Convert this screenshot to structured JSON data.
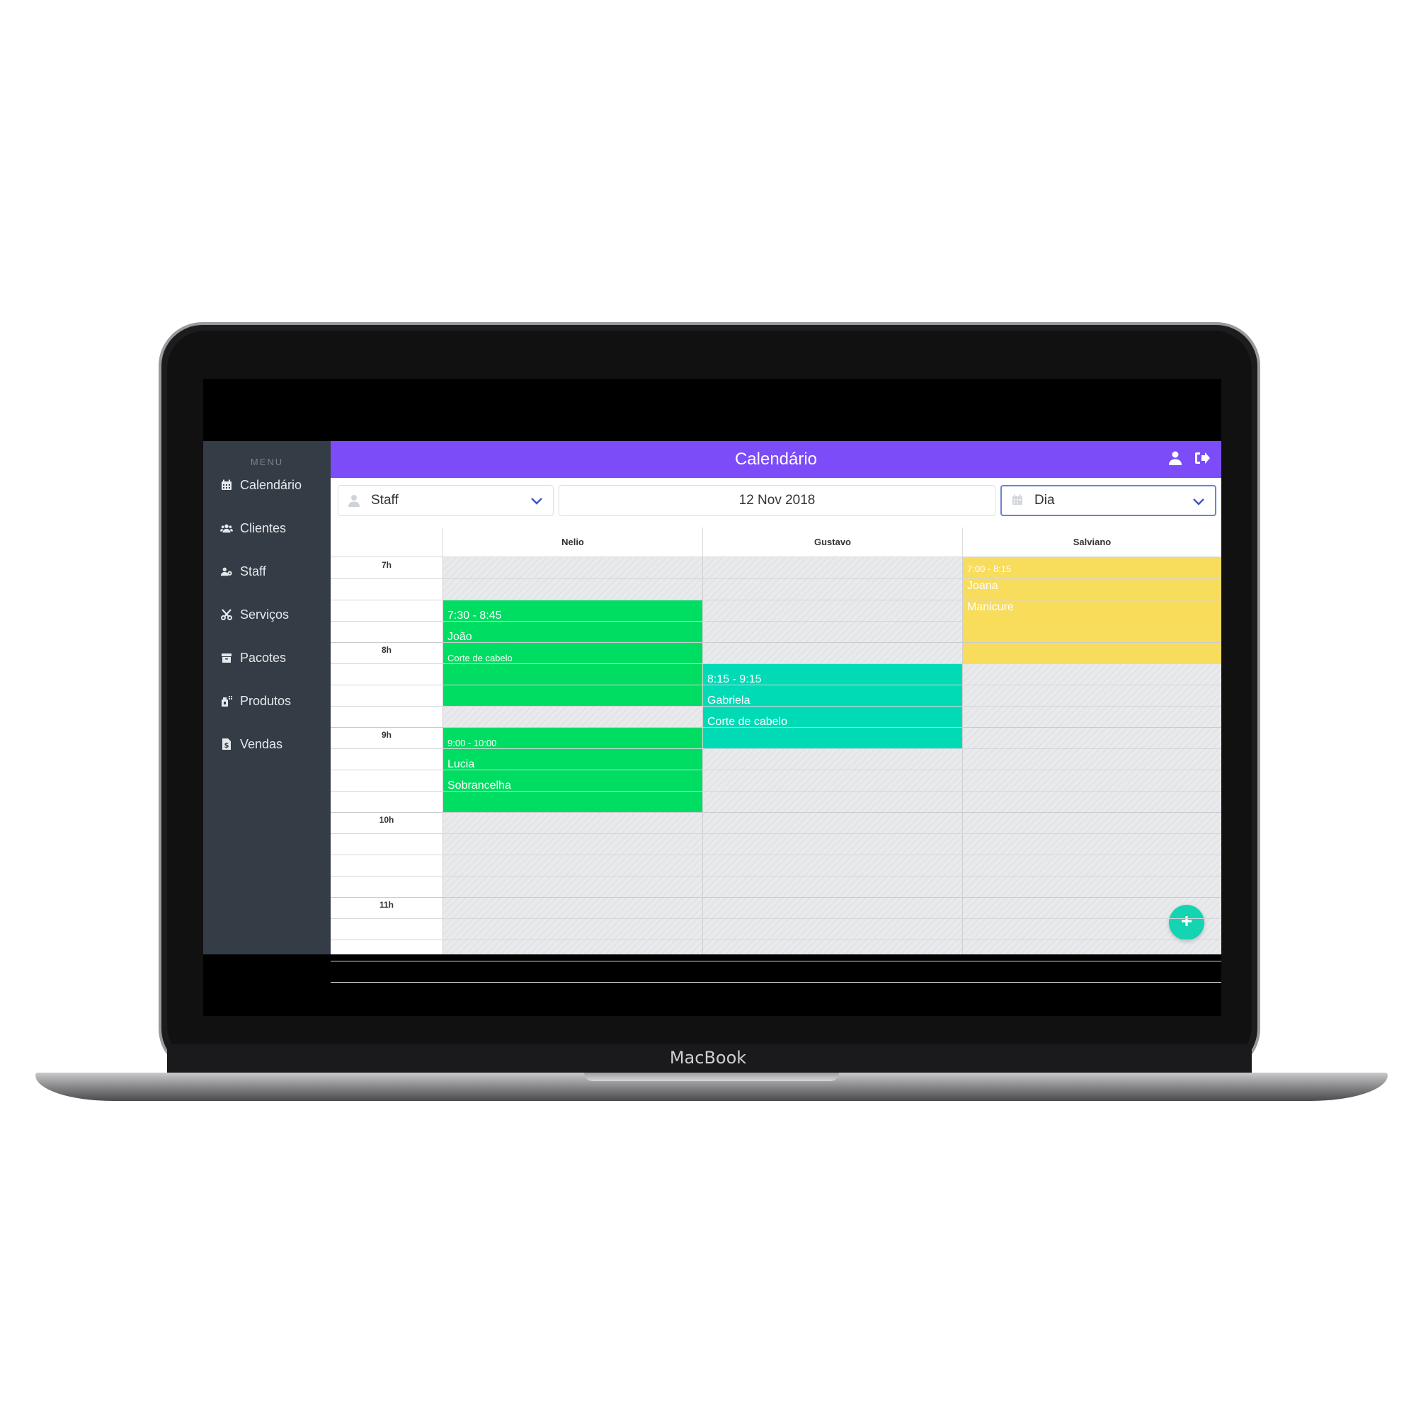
{
  "device": {
    "brand": "MacBook"
  },
  "sidebar": {
    "title": "MENU",
    "items": [
      {
        "label": "Calendário",
        "icon": "calendar-icon"
      },
      {
        "label": "Clientes",
        "icon": "users-icon"
      },
      {
        "label": "Staff",
        "icon": "users-gear-icon"
      },
      {
        "label": "Serviços",
        "icon": "scissors-icon"
      },
      {
        "label": "Pacotes",
        "icon": "box-icon"
      },
      {
        "label": "Produtos",
        "icon": "bottle-icon"
      },
      {
        "label": "Vendas",
        "icon": "file-dollar-icon"
      }
    ]
  },
  "header": {
    "title": "Calendário",
    "accent": "#7b4cf7"
  },
  "toolbar": {
    "staff": {
      "value": "Staff",
      "icon": "user-icon"
    },
    "date": "12 Nov 2018",
    "view": {
      "value": "Dia",
      "icon": "calendar-icon"
    }
  },
  "calendar": {
    "columns": [
      "Nelio",
      "Gustavo",
      "Salviano"
    ],
    "hours": [
      "7h",
      "8h",
      "9h",
      "10h",
      "11h"
    ],
    "events": [
      {
        "column": 0,
        "start": "7:30",
        "end": "8:45",
        "time": "7:30 - 8:45",
        "client": "João",
        "service": "Corte de cabelo",
        "color": "#00dd63"
      },
      {
        "column": 0,
        "start": "9:00",
        "end": "10:00",
        "time": "9:00 - 10:00",
        "client": "Lucia",
        "service": "Sobrancelha",
        "color": "#00dd63"
      },
      {
        "column": 1,
        "start": "8:15",
        "end": "9:15",
        "time": "8:15 - 9:15",
        "client": "Gabriela",
        "service": "Corte de cabelo",
        "color": "#00dbb6"
      },
      {
        "column": 2,
        "start": "7:00",
        "end": "8:15",
        "time": "7:00 - 8:15",
        "client": "Joana",
        "service": "Manicure",
        "color": "#f8dc5c"
      }
    ]
  },
  "fab": {
    "icon": "plus-icon",
    "color": "#14d4b1"
  }
}
